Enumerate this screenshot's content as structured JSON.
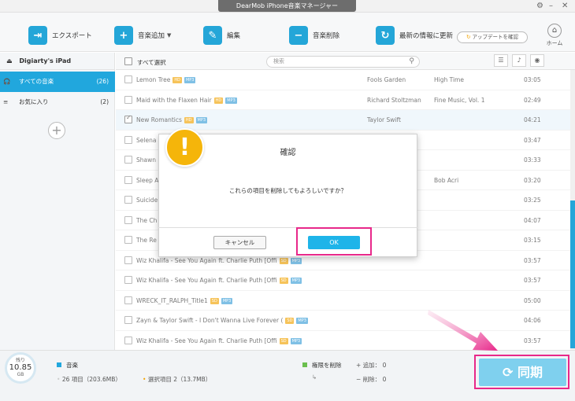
{
  "app": {
    "title": "DearMob iPhone音楽マネージャー"
  },
  "toolbar": {
    "export": "エクスポート",
    "add_music": "音楽追加",
    "edit": "編集",
    "delete_music": "音楽削除",
    "refresh": "最新の情報に更新",
    "update_check": "アップデートを確認",
    "home": "ホーム"
  },
  "sidebar": {
    "device": "Digiarty's iPad",
    "items": [
      {
        "label": "すべての音楽",
        "count": "(26)"
      },
      {
        "label": "お気に入り",
        "count": "(2)"
      }
    ]
  },
  "list": {
    "select_all": "すべて選択",
    "search_placeholder": "検索",
    "rows": [
      {
        "title": "Lemon Tree",
        "tags": [
          "HD",
          "MP3"
        ],
        "artist": "Fools Garden",
        "album": "High Time",
        "time": "03:05"
      },
      {
        "title": "Maid with the Flaxen Hair",
        "tags": [
          "HD",
          "MP3"
        ],
        "artist": "Richard Stoltzman",
        "album": "Fine Music, Vol. 1",
        "time": "02:49"
      },
      {
        "title": "New Romantics",
        "tags": [
          "HD",
          "MP3"
        ],
        "artist": "Taylor Swift",
        "album": "",
        "time": "04:21"
      },
      {
        "title": "Selena",
        "tags": [],
        "artist": "",
        "album": "",
        "time": "03:47"
      },
      {
        "title": "Shawn",
        "tags": [],
        "artist": "",
        "album": "",
        "time": "03:33"
      },
      {
        "title": "Sleep A",
        "tags": [],
        "artist": "",
        "album": "Bob Acri",
        "time": "03:20"
      },
      {
        "title": "Suicide",
        "tags": [],
        "artist": "",
        "album": "",
        "time": "03:25"
      },
      {
        "title": "The Ch",
        "tags": [],
        "artist": "",
        "album": "",
        "time": "04:07"
      },
      {
        "title": "The Re",
        "tags": [],
        "artist": "",
        "album": "",
        "time": "03:15"
      },
      {
        "title": "Wiz Khalifa - See You Again ft. Charlie Puth [Offi",
        "tags": [
          "SD",
          "MP3"
        ],
        "artist": "",
        "album": "",
        "time": "03:57"
      },
      {
        "title": "Wiz Khalifa - See You Again ft. Charlie Puth [Offi",
        "tags": [
          "SD",
          "MP3"
        ],
        "artist": "",
        "album": "",
        "time": "03:57"
      },
      {
        "title": "WRECK_IT_RALPH_Title1",
        "tags": [
          "SD",
          "MP3"
        ],
        "artist": "",
        "album": "",
        "time": "05:00"
      },
      {
        "title": "Zayn & Taylor Swift - I Don't Wanna Live Forever (",
        "tags": [
          "SD",
          "MP3"
        ],
        "artist": "",
        "album": "",
        "time": "04:06"
      },
      {
        "title": "Wiz Khalifa - See You Again ft. Charlie Puth [Offi",
        "tags": [
          "SD",
          "MP3"
        ],
        "artist": "",
        "album": "",
        "time": "03:57"
      }
    ]
  },
  "dialog": {
    "title": "確認",
    "message": "これらの項目を削除してもよろしいですか？",
    "cancel": "キャンセル",
    "ok": "OK"
  },
  "footer": {
    "storage_label": "残り",
    "storage_value": "10.85",
    "storage_unit": "GB",
    "category": "音楽",
    "total_items": "26 項目（203.6MB）",
    "selected_items": "選択項目 2（13.7MB）",
    "delete_pending": "権限を削除",
    "added": "追加： 0",
    "removed": "削除： 0",
    "sync": "同期"
  },
  "colors": {
    "accent": "#21a7dd",
    "highlight": "#e8288a",
    "warning": "#f5b50a"
  }
}
